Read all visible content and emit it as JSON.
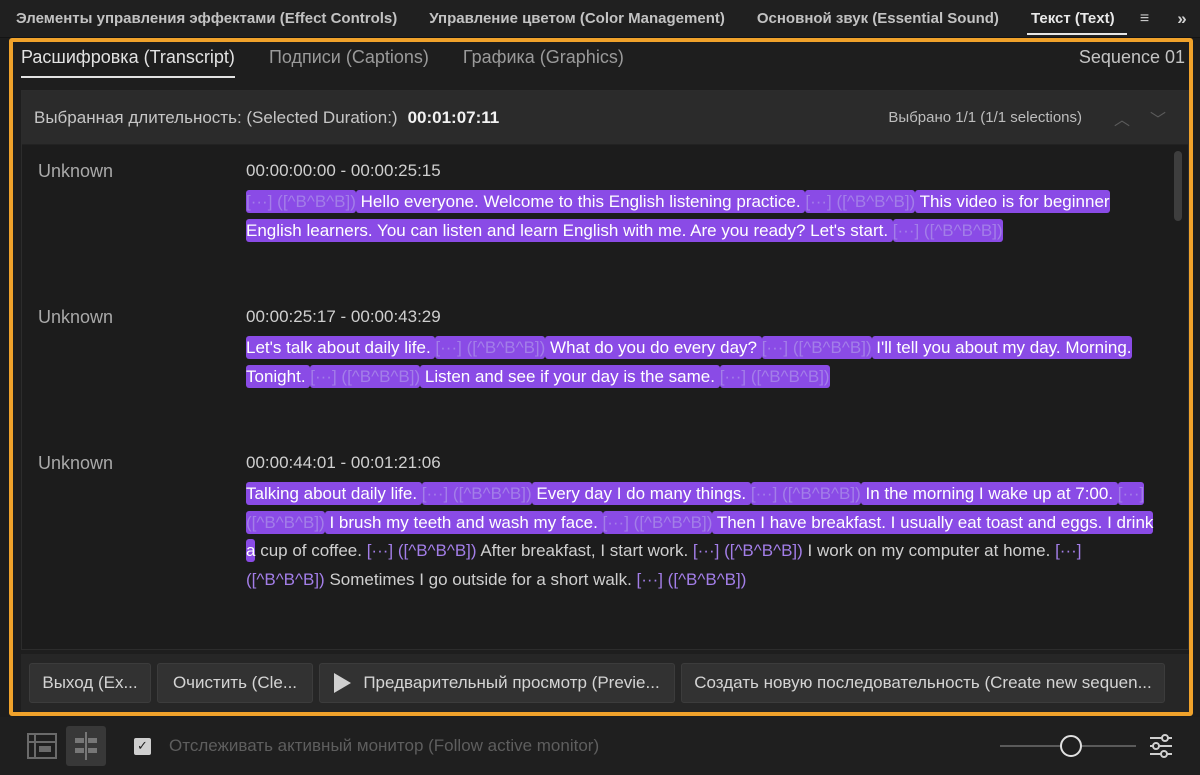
{
  "panel_tabs": [
    {
      "label": "Элементы управления эффектами (Effect Controls)"
    },
    {
      "label": "Управление цветом (Color Management)"
    },
    {
      "label": "Основной звук (Essential Sound)"
    },
    {
      "label": "Текст (Text)"
    }
  ],
  "panel_menu_icon": "hamburger-menu-icon",
  "panel_overflow_icon": "double-chevron-right-icon",
  "sub_tabs": [
    {
      "label": "Расшифровка (Transcript)"
    },
    {
      "label": "Подписи (Captions)"
    },
    {
      "label": "Графика (Graphics)"
    }
  ],
  "sequence_name": "Sequence 01",
  "selection": {
    "label": "Выбранная длительность: (Selected Duration:)",
    "value": "00:01:07:11",
    "count": "Выбрано 1/1 (1/1 selections)"
  },
  "segments": [
    {
      "speaker": "Unknown",
      "timecode": "00:00:00:00 - 00:00:25:15",
      "parts": [
        {
          "t": "[···] ([^B^B^B])",
          "pause": true,
          "sel": true
        },
        {
          "t": " Hello everyone. Welcome to this English listening practice. ",
          "sel": true
        },
        {
          "t": "[···] ([^B^B^B])",
          "pause": true,
          "sel": true
        },
        {
          "t": " This video is for beginner English learners. You can listen and learn English with me. Are you ready? Let's start. ",
          "sel": true
        },
        {
          "t": "[···] ([^B^B^B])",
          "pause": true,
          "sel": true
        }
      ]
    },
    {
      "speaker": "Unknown",
      "timecode": "00:00:25:17 - 00:00:43:29",
      "parts": [
        {
          "t": "Let's talk about daily life. ",
          "sel": true
        },
        {
          "t": "[···] ([^B^B^B])",
          "pause": true,
          "sel": true
        },
        {
          "t": " What do you do every day? ",
          "sel": true
        },
        {
          "t": "[···] ([^B^B^B])",
          "pause": true,
          "sel": true
        },
        {
          "t": " I'll tell you about my day. Morning. Tonight. ",
          "sel": true
        },
        {
          "t": "[···] ([^B^B^B])",
          "pause": true,
          "sel": true
        },
        {
          "t": " Listen and see if your day is the same. ",
          "sel": true
        },
        {
          "t": "[···] ([^B^B^B])",
          "pause": true,
          "sel": true
        }
      ]
    },
    {
      "speaker": "Unknown",
      "timecode": "00:00:44:01 - 00:01:21:06",
      "parts": [
        {
          "t": "Talking about daily life. ",
          "sel": true
        },
        {
          "t": "[···] ([^B^B^B])",
          "pause": true,
          "sel": true
        },
        {
          "t": " Every day I do many things. ",
          "sel": true
        },
        {
          "t": "[···] ([^B^B^B])",
          "pause": true,
          "sel": true
        },
        {
          "t": " In the morning I wake up at 7:00. ",
          "sel": true
        },
        {
          "t": "[···] ([^B^B^B])",
          "pause": true,
          "sel": true
        },
        {
          "t": " I brush my teeth and wash my face. ",
          "sel": true
        },
        {
          "t": "[···] ([^B^B^B])",
          "pause": true,
          "sel": true
        },
        {
          "t": " Then I have breakfast. I usually eat toast and eggs. I drink a",
          "sel": true
        },
        {
          "t": " cup of coffee. ",
          "sel": false
        },
        {
          "t": "[···] ([^B^B^B])",
          "pause": true,
          "sel": false
        },
        {
          "t": " After breakfast, I start work. ",
          "sel": false
        },
        {
          "t": "[···] ([^B^B^B])",
          "pause": true,
          "sel": false
        },
        {
          "t": " I work on my computer at home. ",
          "sel": false
        },
        {
          "t": "[···] ([^B^B^B])",
          "pause": true,
          "sel": false
        },
        {
          "t": " Sometimes I go outside for a short walk. ",
          "sel": false
        },
        {
          "t": "[···] ([^B^B^B])",
          "pause": true,
          "sel": false
        }
      ]
    }
  ],
  "buttons": {
    "exit": "Выход (Ex...",
    "clear": "Очистить (Cle...",
    "preview": "Предварительный просмотр (Previe...",
    "create": "Создать новую последовательность (Create new sequen..."
  },
  "bottom": {
    "follow_label": "Отслеживать активный монитор (Follow active monitor)",
    "follow_checked": true
  },
  "colors": {
    "selection": "#8a4be6",
    "frame_highlight": "#f0a22b"
  }
}
